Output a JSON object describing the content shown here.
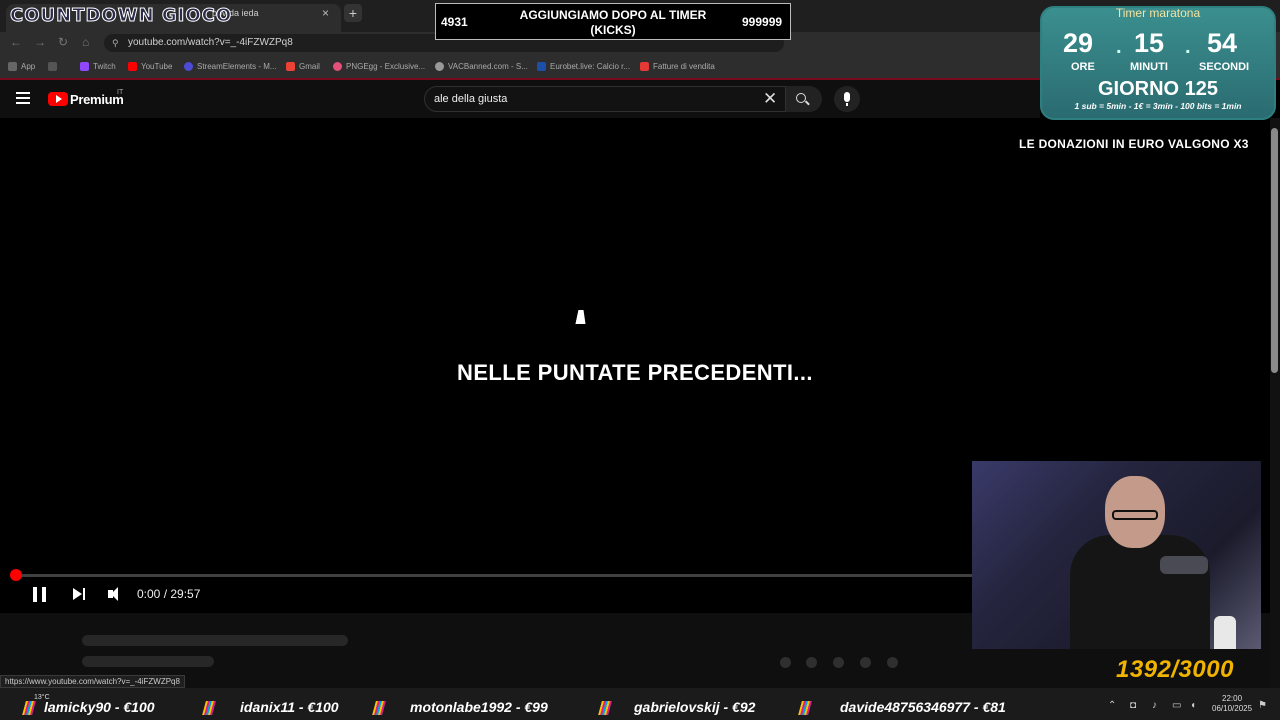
{
  "browser": {
    "tab_title": "pov da ieda",
    "new_tab": "+",
    "close": "×",
    "url": "youtube.com/watch?v=_-4iFZWZPq8",
    "bookmarks": [
      "App",
      "Twitch",
      "YouTube",
      "StreamElements - M...",
      "Gmail",
      "PNGEgg - Exclusive...",
      "VACBanned.com - S...",
      "Eurobet.live: Calcio r...",
      "Fatture di vendita"
    ],
    "status_url": "https://www.youtube.com/watch?v=_-4iFZWZPq8"
  },
  "overlay": {
    "title": "COUNTDOWN GIOCO",
    "timer_left": "4931",
    "timer_text": "AGGIUNGIAMO DOPO AL TIMER (KICKS)",
    "timer_right": "999999",
    "marathon_title": "Timer maratona",
    "hours": "29",
    "minutes": "15",
    "seconds": "54",
    "hours_label": "ORE",
    "minutes_label": "MINUTI",
    "seconds_label": "SECONDI",
    "day": "GIORNO 125",
    "rules": "1 sub = 5min - 1€ = 3min - 100 bits = 1min",
    "donation": "LE DONAZIONI IN EURO VALGONO X3",
    "counter": "1392/3000"
  },
  "youtube": {
    "brand": "Premium",
    "country": "IT",
    "search_value": "ale della giusta",
    "video_caption": "NELLE PUNTATE PRECEDENTI...",
    "time": "0:00 / 29:57",
    "progress": 0.0
  },
  "ticker": [
    {
      "text": "lamicky90 - €100"
    },
    {
      "text": "idanix11 - €100"
    },
    {
      "text": "motonlabe1992 - €99"
    },
    {
      "text": "gabrielovskij - €92"
    },
    {
      "text": "davide48756346977 - €81"
    }
  ],
  "taskbar": {
    "temperature": "13°C",
    "time": "22:00",
    "date": "06/10/2025"
  },
  "colors": {
    "youtube_red": "#ff0000",
    "marathon_teal": "#3b8f8f",
    "counter_gold": "#f0b400"
  }
}
